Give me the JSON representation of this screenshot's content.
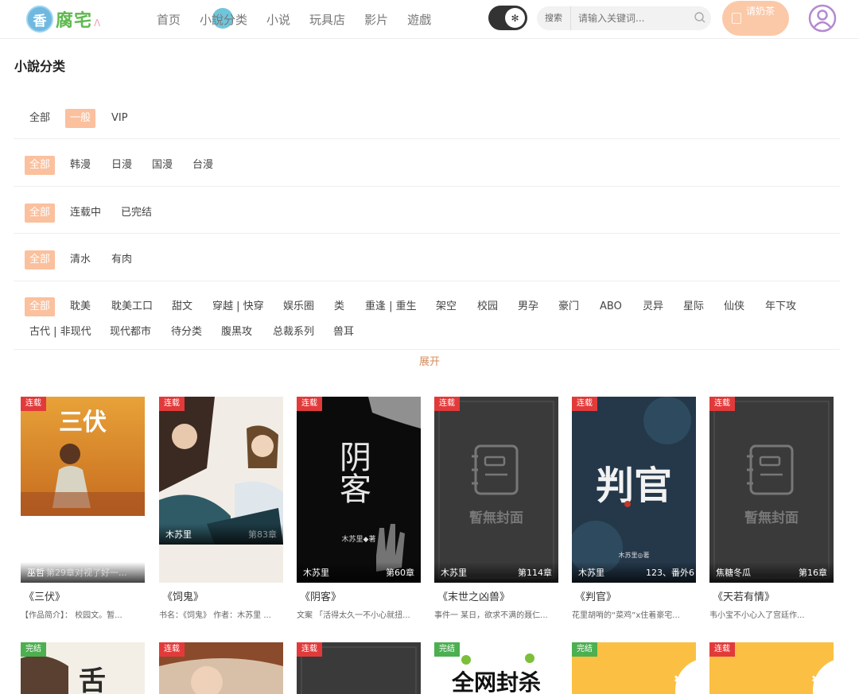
{
  "header": {
    "logo_badge": "香",
    "logo_text": "腐宅",
    "nav": [
      "首页",
      "小說分类",
      "小说",
      "玩具店",
      "影片",
      "遊戲"
    ],
    "search_label": "搜索",
    "search_placeholder": "请输入关键词...",
    "tea_button": "请奶茶"
  },
  "page_title": "小說分类",
  "filters": {
    "row1": [
      "全部",
      "一般",
      "VIP"
    ],
    "row2": [
      "全部",
      "韩漫",
      "日漫",
      "国漫",
      "台漫"
    ],
    "row3": [
      "全部",
      "连载中",
      "已完结"
    ],
    "row4": [
      "全部",
      "清水",
      "有肉"
    ],
    "row5": [
      "全部",
      "耽美",
      "耽美工口",
      "甜文",
      "穿越 | 快穿",
      "娱乐圈",
      "类",
      "重逢 | 重生",
      "架空",
      "校园",
      "男孕",
      "豪门",
      "ABO",
      "灵异",
      "星际",
      "仙侠",
      "年下攻"
    ],
    "row6": [
      "古代 | 非现代",
      "现代都市",
      "待分类",
      "腹黑攻",
      "总裁系列",
      "兽耳"
    ],
    "expand": "展开"
  },
  "books": [
    {
      "status": "连载",
      "author": "巫哲",
      "chapters": "第29章对视了好一...",
      "title": "《三伏》",
      "desc": "【作品简介】：   校园文。暂..."
    },
    {
      "status": "连载",
      "author": "木苏里",
      "chapters": "第83章",
      "title": "《饲鬼》",
      "desc": "书名：《饲鬼》 作者：木苏里 ..."
    },
    {
      "status": "连载",
      "author": "木苏里",
      "chapters": "第60章",
      "title": "《阴客》",
      "desc": "文案 「活得太久一不小心就扭..."
    },
    {
      "status": "连载",
      "author": "木苏里",
      "chapters": "第114章",
      "title": "《末世之凶兽》",
      "desc": "事件一 某日，欲求不满的聂仁..."
    },
    {
      "status": "连载",
      "author": "木苏里",
      "chapters": "123、番外6",
      "title": "《判官》",
      "desc": "花里胡哨的“菜鸡”x住着豪宅..."
    },
    {
      "status": "连载",
      "author": "焦糖冬瓜",
      "chapters": "第16章",
      "title": "《天若有情》",
      "desc": "韦小宝不小心入了宫廷作..."
    }
  ],
  "books_row2_status": [
    "完结",
    "连载",
    "连载",
    "完结",
    "完结",
    "连载"
  ],
  "cover_text": {
    "sanfu": "三伏",
    "yinke": "阴客",
    "panguan": "判官",
    "no_cover": "暫無封面",
    "yinke_author": "木苏里◆著",
    "panguan_author": "木苏里◎著"
  },
  "colors": {
    "accent": "#fbc09d",
    "status_red": "#e23a3a",
    "status_green": "#4caf50"
  }
}
